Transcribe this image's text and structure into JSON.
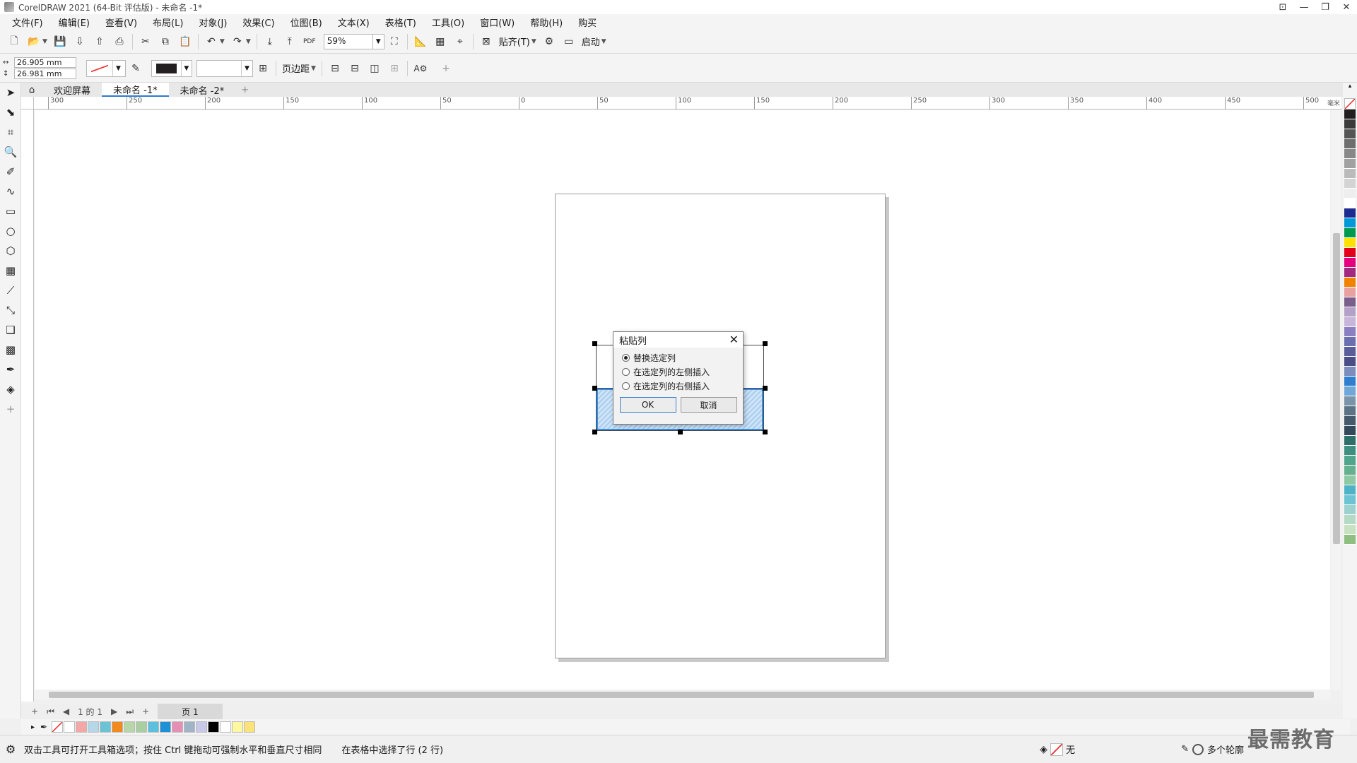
{
  "window": {
    "title": "CorelDRAW 2021 (64-Bit 评估版) - 未命名 -1*",
    "min": "—",
    "max": "❐",
    "close": "✕"
  },
  "menu": [
    "文件(F)",
    "编辑(E)",
    "查看(V)",
    "布局(L)",
    "对象(J)",
    "效果(C)",
    "位图(B)",
    "文本(X)",
    "表格(T)",
    "工具(O)",
    "窗口(W)",
    "帮助(H)",
    "购买"
  ],
  "toolbar": {
    "zoom": "59%",
    "snap_label": "贴齐(T)",
    "launch_label": "启动"
  },
  "propbar": {
    "width": "26.905 mm",
    "height": "26.981 mm",
    "margin_label": "页边距"
  },
  "tabs": [
    {
      "label": "欢迎屏幕",
      "active": false
    },
    {
      "label": "未命名 -1*",
      "active": true
    },
    {
      "label": "未命名 -2*",
      "active": false
    }
  ],
  "ruler": {
    "ticks": [
      "300",
      "250",
      "200",
      "150",
      "100",
      "50",
      "0",
      "50",
      "100",
      "150",
      "200",
      "250",
      "300",
      "350",
      "400",
      "450",
      "500"
    ],
    "unit": "毫米"
  },
  "dialog": {
    "title": "粘贴列",
    "close": "✕",
    "options": [
      {
        "label": "替换选定列",
        "selected": true
      },
      {
        "label": "在选定列的左侧插入",
        "selected": false
      },
      {
        "label": "在选定列的右侧插入",
        "selected": false
      }
    ],
    "ok": "OK",
    "cancel": "取消"
  },
  "pagebar": {
    "position": "1 的 1",
    "page_tab": "页 1"
  },
  "status": {
    "hint": "双击工具可打开工具箱选项；按住 Ctrl 键拖动可强制水平和垂直尺寸相同",
    "selection": "在表格中选择了行 (2 行)",
    "fill": "无",
    "outline": "多个轮廓"
  },
  "watermark": "最需教育",
  "colors": {
    "accent": "#2a7bd3",
    "selection_fill": "#a9cdf0",
    "doc_palette": [
      "#ffffff",
      "#f4a7a7",
      "#b5d7e8",
      "#6cc3d5",
      "#f08a1c",
      "#b7d7a8",
      "#a9cfa0",
      "#5bc0de",
      "#1e90d6",
      "#e58fb5",
      "#a0b4c8",
      "#c8c8e8",
      "#000000",
      "#ffffff",
      "#fff8a0",
      "#fde27a"
    ],
    "color_palette": [
      "#231f20",
      "#3b3b3b",
      "#555555",
      "#6e6e6e",
      "#888888",
      "#a1a1a1",
      "#bbbbbb",
      "#d4d4d4",
      "#eeeeee",
      "#ffffff",
      "#1c2b8f",
      "#0099d8",
      "#009a4e",
      "#ffe100",
      "#e3001b",
      "#e4007f",
      "#a2297f",
      "#f08300",
      "#e8a0a0",
      "#7a5f8c",
      "#b5a0c8",
      "#c7b6da",
      "#8a7fc0",
      "#6b6fb0",
      "#5a5d9a",
      "#4a4e85",
      "#7a8dbd",
      "#2f7fcf",
      "#6fa8d8",
      "#7b95a8",
      "#5d7486",
      "#455a6a",
      "#34495a",
      "#2f6f6a",
      "#3f8f80",
      "#51a58c",
      "#65b18f",
      "#8ec9a4",
      "#4fb3c8",
      "#6cc4d2",
      "#9bd2cf",
      "#b4d9c4",
      "#c6e2c0",
      "#8fbf80"
    ]
  }
}
